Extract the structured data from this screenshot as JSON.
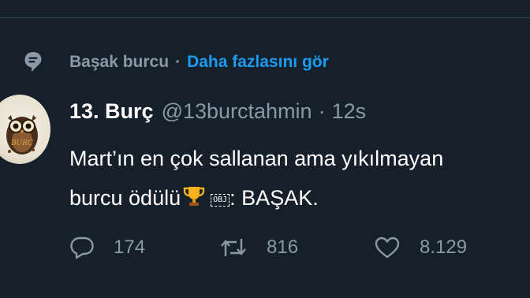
{
  "context": {
    "topic": "Başak burcu",
    "separator": "·",
    "see_more": "Daha fazlasını gör"
  },
  "tweet": {
    "name": "13. Burç",
    "handle": "@13burctahmin",
    "separator": "·",
    "time": "12s",
    "text_line1": "Mart’ın en çok sallanan ama yıkılmayan",
    "text_line2_start": "burcu ödülü",
    "obj_label": "OBJ",
    "text_line2_end": ": BAŞAK.",
    "emoji": "trophy",
    "avatar_caption": "BURÇ"
  },
  "actions": {
    "reply_count": "174",
    "retweet_count": "816",
    "like_count": "8.129"
  },
  "colors": {
    "background": "#15202b",
    "accent": "#1d9bf0",
    "secondary_text": "#8b98a5",
    "divider": "#38444d"
  },
  "icons": {
    "context": "topic-icon",
    "reply": "reply-icon",
    "retweet": "retweet-icon",
    "like": "heart-icon"
  }
}
